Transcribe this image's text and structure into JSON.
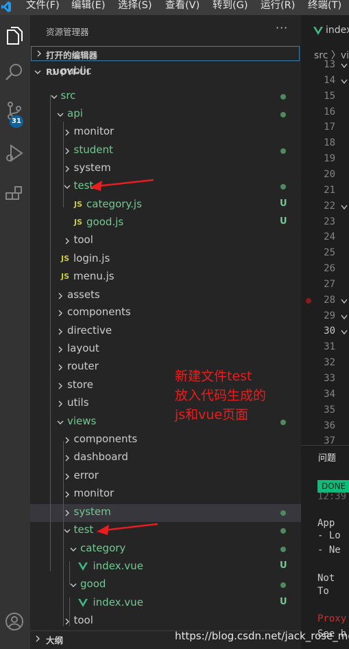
{
  "menubar": {
    "items": [
      "文件(F)",
      "编辑(E)",
      "选择(S)",
      "查看(V)",
      "转到(G)",
      "运行(R)",
      "终端(T)"
    ]
  },
  "activitybar": {
    "icons": [
      "explorer-icon",
      "search-icon",
      "source-control-icon",
      "run-debug-icon",
      "extensions-icon",
      "accounts-icon"
    ],
    "scm_badge": "31"
  },
  "sidebar": {
    "title": "资源管理器",
    "more": "···",
    "open_editors": "打开的编辑器",
    "project": "RUOYI-UI",
    "outline": "大纲",
    "rows": [
      {
        "label": "public",
        "kind": "folder",
        "color": "#cccccc"
      },
      {
        "label": "src",
        "kind": "folder",
        "color": "#73c991",
        "dot": true
      },
      {
        "label": "api",
        "kind": "folder",
        "color": "#73c991",
        "dot": true
      },
      {
        "label": "monitor",
        "kind": "folder",
        "color": "#cccccc"
      },
      {
        "label": "student",
        "kind": "folder",
        "color": "#73c991",
        "dot": true
      },
      {
        "label": "system",
        "kind": "folder",
        "color": "#cccccc"
      },
      {
        "label": "test",
        "kind": "folder",
        "color": "#73c991",
        "dot": true
      },
      {
        "label": "category.js",
        "kind": "js",
        "color": "#73c991",
        "status": "U"
      },
      {
        "label": "good.js",
        "kind": "js",
        "color": "#73c991",
        "status": "U"
      },
      {
        "label": "tool",
        "kind": "folder",
        "color": "#cccccc"
      },
      {
        "label": "login.js",
        "kind": "js",
        "color": "#cccccc"
      },
      {
        "label": "menu.js",
        "kind": "js",
        "color": "#cccccc"
      },
      {
        "label": "assets",
        "kind": "folder",
        "color": "#cccccc"
      },
      {
        "label": "components",
        "kind": "folder",
        "color": "#cccccc"
      },
      {
        "label": "directive",
        "kind": "folder",
        "color": "#cccccc"
      },
      {
        "label": "layout",
        "kind": "folder",
        "color": "#cccccc"
      },
      {
        "label": "router",
        "kind": "folder",
        "color": "#cccccc"
      },
      {
        "label": "store",
        "kind": "folder",
        "color": "#cccccc"
      },
      {
        "label": "utils",
        "kind": "folder",
        "color": "#cccccc"
      },
      {
        "label": "views",
        "kind": "folder",
        "color": "#73c991",
        "dot": true
      },
      {
        "label": "components",
        "kind": "folder",
        "color": "#cccccc"
      },
      {
        "label": "dashboard",
        "kind": "folder",
        "color": "#cccccc"
      },
      {
        "label": "error",
        "kind": "folder",
        "color": "#cccccc"
      },
      {
        "label": "monitor",
        "kind": "folder",
        "color": "#cccccc"
      },
      {
        "label": "system",
        "kind": "folder",
        "color": "#73c991",
        "dot": true,
        "selected": true
      },
      {
        "label": "test",
        "kind": "folder",
        "color": "#73c991",
        "dot": true
      },
      {
        "label": "category",
        "kind": "folder",
        "color": "#73c991",
        "dot": true
      },
      {
        "label": "index.vue",
        "kind": "vue",
        "color": "#73c991",
        "status": "U"
      },
      {
        "label": "good",
        "kind": "folder",
        "color": "#73c991",
        "dot": true
      },
      {
        "label": "index.vue",
        "kind": "vue",
        "color": "#73c991",
        "status": "U"
      },
      {
        "label": "tool",
        "kind": "folder",
        "color": "#cccccc"
      }
    ]
  },
  "editor": {
    "tab_label": "index",
    "breadcrumb": "src 〉vi",
    "line_numbers": [
      "13",
      "14",
      "15",
      "16",
      "17",
      "18",
      "19",
      "20",
      "21",
      "22",
      "23",
      "24",
      "25",
      "26",
      "27",
      "28",
      "29",
      "30",
      "31",
      "32",
      "33",
      "34",
      "35",
      "36",
      "37"
    ],
    "current_line": "30",
    "breakpoint_line": "28"
  },
  "panel": {
    "tab": "问题",
    "done": "DONE",
    "time": "12:39",
    "lines": [
      "App",
      "- Lo",
      "- Ne",
      "",
      "Not",
      "To",
      "",
      "Proxy",
      "See h"
    ]
  },
  "annotation": {
    "line1": "新建文件test",
    "line2": "放入代码生成的",
    "line3": "js和vue页面"
  },
  "watermark": "https://blog.csdn.net/jack_rose_me",
  "colors": {
    "git_untracked": "#73c991",
    "dot": "#4f8a5e",
    "accent_blue": "#0e639c",
    "annotation_red": "#e81e1e",
    "done_green": "#0dbc79"
  }
}
